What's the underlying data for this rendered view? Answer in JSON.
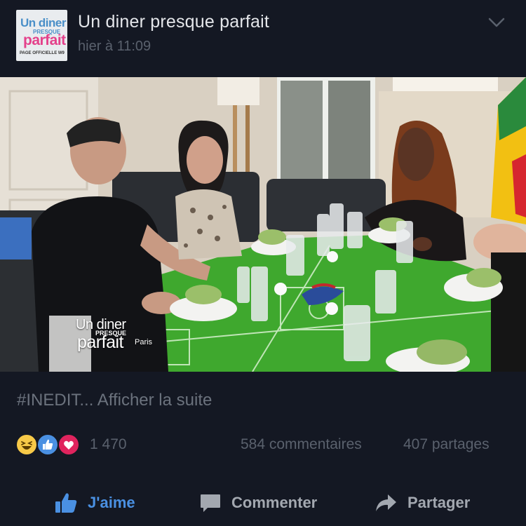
{
  "post": {
    "page_logo": {
      "line1": "Un diner",
      "line2": "PRESQUE",
      "line3": "parfait",
      "line4": "PAGE OFFICIELLE W9"
    },
    "page_name": "Un diner presque parfait",
    "time": "hier à 11:09",
    "photo_watermark": {
      "line1": "Un diner",
      "line2": "PRESQUE",
      "line3": "parfait",
      "city": "Paris"
    },
    "caption": "#INEDIT... Afficher la suite",
    "reactions": {
      "icons": [
        "haha-icon",
        "like-icon",
        "love-icon"
      ],
      "count": "1 470"
    },
    "comments": "584 commentaires",
    "shares": "407 partages"
  },
  "actions": {
    "like_label": "J'aime",
    "comment_label": "Commenter",
    "share_label": "Partager"
  },
  "colors": {
    "background": "#141823",
    "accent_blue": "#4a90e2",
    "muted_text": "#5a616d",
    "love_red": "#e0245e",
    "haha_yellow": "#f7c948"
  }
}
